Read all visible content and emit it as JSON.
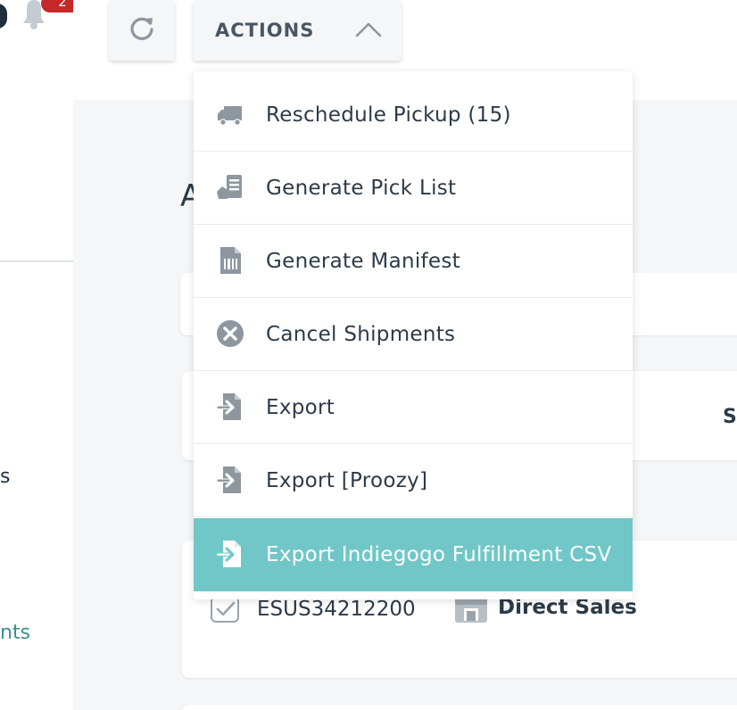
{
  "notifications": {
    "count": "2"
  },
  "sidebar": {
    "partial_text_1": "s",
    "partial_text_2": "nts"
  },
  "toolbar": {
    "refresh_icon": "refresh-icon",
    "actions_label": "ACTIONS",
    "actions_caret_icon": "chevron-up-icon"
  },
  "main": {
    "heading_partial": "A",
    "filter_partial": "S"
  },
  "actions_menu": {
    "items": [
      {
        "label": "Reschedule Pickup (15)",
        "icon": "truck-icon"
      },
      {
        "label": "Generate Pick List",
        "icon": "pick-list-icon"
      },
      {
        "label": "Generate Manifest",
        "icon": "manifest-icon"
      },
      {
        "label": "Cancel Shipments",
        "icon": "cancel-icon"
      },
      {
        "label": "Export",
        "icon": "export-icon"
      },
      {
        "label": "Export [Proozy]",
        "icon": "export-icon"
      },
      {
        "label": "Export Indiegogo Fulfillment CSV",
        "icon": "export-icon",
        "active": true
      }
    ]
  },
  "shipment_row": {
    "order_id": "ESUS34212200",
    "store_name": "Direct Sales",
    "checked": true
  },
  "colors": {
    "active_item": "#71c7c8",
    "badge": "#c62828",
    "link_accent": "#3d8f8b"
  }
}
